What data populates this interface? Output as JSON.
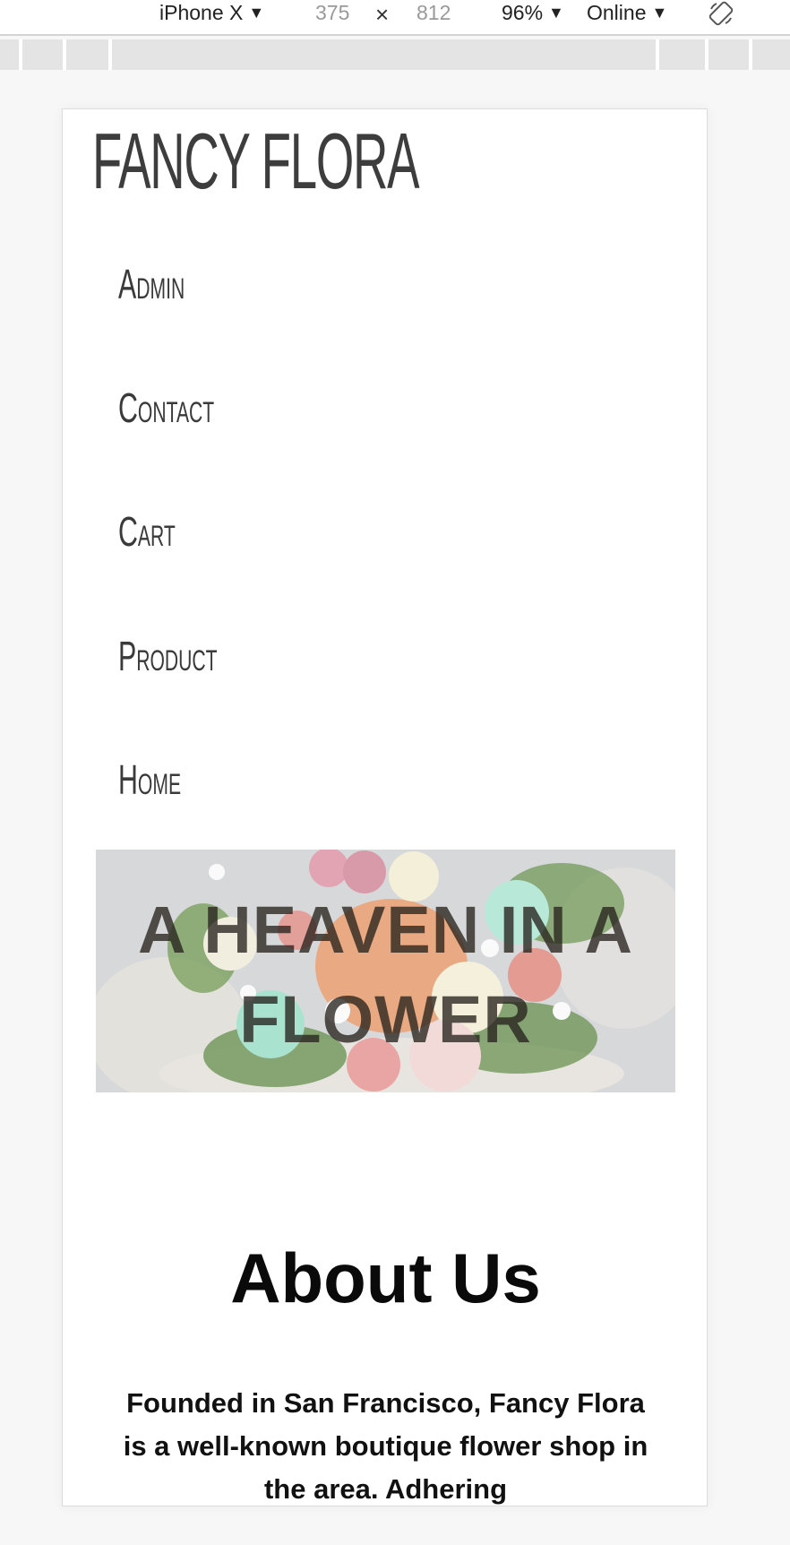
{
  "devtools": {
    "device": "iPhone X",
    "width": "375",
    "times": "×",
    "height": "812",
    "zoom": "96%",
    "network": "Online"
  },
  "site": {
    "brand": "FANCY FLORA",
    "nav": [
      {
        "label": "Admin"
      },
      {
        "label": "Contact"
      },
      {
        "label": "Cart"
      },
      {
        "label": "Product"
      },
      {
        "label": "Home"
      }
    ],
    "hero": {
      "line1": "A HEAVEN IN A",
      "line2": "FLOWER"
    },
    "about": {
      "title": "About Us",
      "text": "Founded in San Francisco, Fancy Flora is a well-known boutique flower shop in the area. Adhering"
    }
  }
}
